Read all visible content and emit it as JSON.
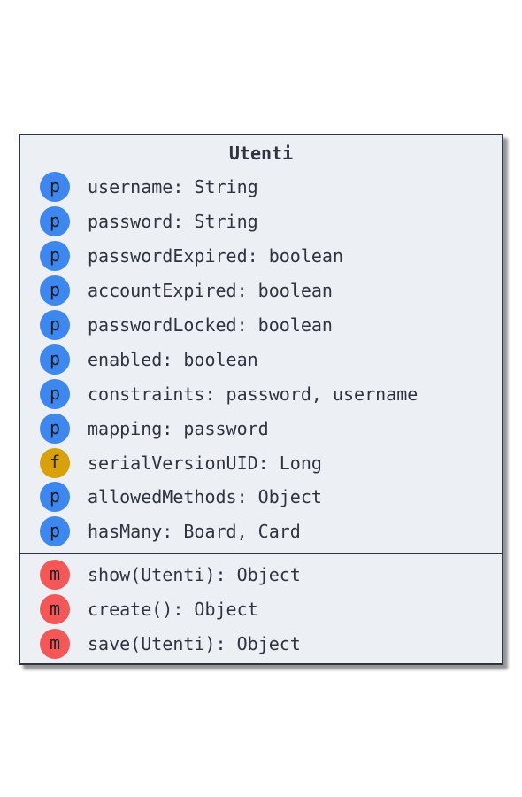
{
  "class": {
    "name": "Utenti",
    "fields": [
      {
        "kind": "p",
        "text": "username: String",
        "color": "#3c87f0"
      },
      {
        "kind": "p",
        "text": "password: String",
        "color": "#3c87f0"
      },
      {
        "kind": "p",
        "text": "passwordExpired: boolean",
        "color": "#3c87f0"
      },
      {
        "kind": "p",
        "text": "accountExpired: boolean",
        "color": "#3c87f0"
      },
      {
        "kind": "p",
        "text": "passwordLocked: boolean",
        "color": "#3c87f0"
      },
      {
        "kind": "p",
        "text": "enabled: boolean",
        "color": "#3c87f0"
      },
      {
        "kind": "p",
        "text": "constraints: password, username",
        "color": "#3c87f0"
      },
      {
        "kind": "p",
        "text": "mapping: password",
        "color": "#3c87f0"
      },
      {
        "kind": "f",
        "text": "serialVersionUID: Long",
        "color": "#d9a106"
      },
      {
        "kind": "p",
        "text": "allowedMethods: Object",
        "color": "#3c87f0"
      },
      {
        "kind": "p",
        "text": "hasMany: Board, Card",
        "color": "#3c87f0"
      }
    ],
    "methods": [
      {
        "kind": "m",
        "text": "show(Utenti): Object",
        "color": "#f55656"
      },
      {
        "kind": "m",
        "text": "create(): Object",
        "color": "#f55656"
      },
      {
        "kind": "m",
        "text": "save(Utenti): Object",
        "color": "#f55656"
      }
    ]
  }
}
